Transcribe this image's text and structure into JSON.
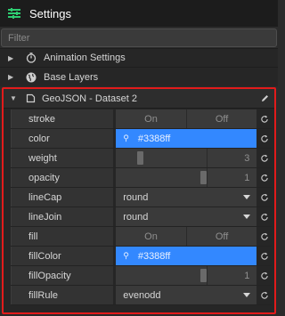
{
  "header": {
    "title": "Settings",
    "icon": "sliders-icon"
  },
  "filter": {
    "placeholder": "Filter",
    "value": ""
  },
  "sections": [
    {
      "label": "Animation Settings",
      "icon": "stopwatch-icon",
      "expanded": false
    },
    {
      "label": "Base Layers",
      "icon": "globe-icon",
      "expanded": false
    }
  ],
  "panel": {
    "title": "GeoJSON - Dataset 2",
    "icon": "shape-icon",
    "expanded": true,
    "highlight_color": "#e21b1b",
    "rows": [
      {
        "label": "stroke",
        "type": "toggle",
        "on": "On",
        "off": "Off"
      },
      {
        "label": "color",
        "type": "color",
        "value": "#3388ff"
      },
      {
        "label": "weight",
        "type": "slider",
        "value": "3",
        "fraction": 0.3
      },
      {
        "label": "opacity",
        "type": "slider",
        "value": "1",
        "fraction": 1.0
      },
      {
        "label": "lineCap",
        "type": "select",
        "value": "round"
      },
      {
        "label": "lineJoin",
        "type": "select",
        "value": "round"
      },
      {
        "label": "fill",
        "type": "toggle",
        "on": "On",
        "off": "Off"
      },
      {
        "label": "fillColor",
        "type": "color",
        "value": "#3388ff"
      },
      {
        "label": "fillOpacity",
        "type": "slider",
        "value": "1",
        "fraction": 1.0
      },
      {
        "label": "fillRule",
        "type": "select",
        "value": "evenodd"
      }
    ]
  }
}
